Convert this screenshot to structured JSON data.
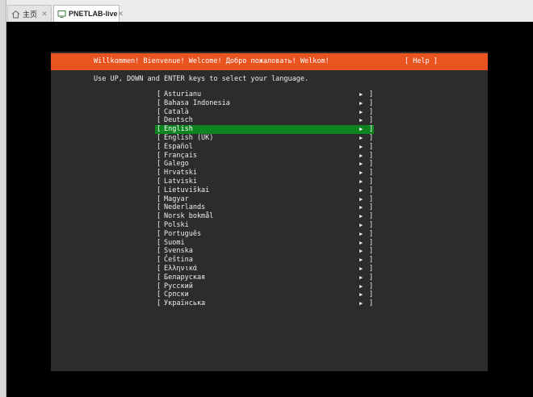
{
  "tabs": [
    {
      "label": "主页",
      "icon": "home-icon",
      "active": false
    },
    {
      "label": "PNETLAB-live",
      "icon": "vm-icon",
      "active": true
    }
  ],
  "installer": {
    "header_title": "Willkommen! Bienvenue! Welcome! Добро пожаловать! Welkom!",
    "help_label": "[ Help ]",
    "instruction": "Use UP, DOWN and ENTER keys to select your language.",
    "left_bracket": "[",
    "right_bracket": "]",
    "arrow": "▶",
    "selected_index": 4,
    "languages": [
      "Asturianu",
      "Bahasa Indonesia",
      "Català",
      "Deutsch",
      "English",
      "English (UK)",
      "Español",
      "Français",
      "Galego",
      "Hrvatski",
      "Latviski",
      "Lietuviškai",
      "Magyar",
      "Nederlands",
      "Norsk bokmål",
      "Polski",
      "Português",
      "Suomi",
      "Svenska",
      "Čeština",
      "Ελληνικά",
      "Беларуская",
      "Русский",
      "Српски",
      "Українська"
    ]
  },
  "colors": {
    "accent": "#e95420",
    "selection": "#0e8420",
    "console_bg": "#2c2c2c"
  }
}
